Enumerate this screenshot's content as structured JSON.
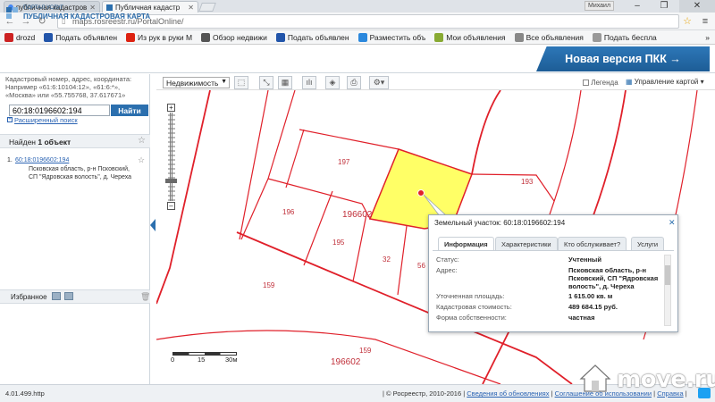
{
  "browser": {
    "tabs": [
      {
        "label": "публичная кадастров",
        "favicon_color": "#4285f4"
      },
      {
        "label": "Публичная кадастр",
        "favicon_color": "#2b6fae"
      }
    ],
    "user_label": "Михаил",
    "url": "maps.rosreestr.ru/PortalOnline/",
    "bookmarks": [
      {
        "label": "drozd",
        "color": "#cc2222"
      },
      {
        "label": "Подать объявлен",
        "color": "#2255aa"
      },
      {
        "label": "Из рук в руки М",
        "color": "#dd2211"
      },
      {
        "label": "Обзор недвижи",
        "color": "#555555"
      },
      {
        "label": "Подать объявлен",
        "color": "#2255aa"
      },
      {
        "label": "Разместить объ",
        "color": "#2b88dd"
      },
      {
        "label": "Мои объявления",
        "color": "#88aa33"
      },
      {
        "label": "Все объявления",
        "color": "#888888"
      },
      {
        "label": "Подать беспла",
        "color": "#999999"
      }
    ]
  },
  "header": {
    "logo_top": "ПОРТАЛ УСЛУГ",
    "logo_title": "ПУБЛИЧНАЯ КАДАСТРОВАЯ КАРТА",
    "new_version": "Новая версия ПКК →"
  },
  "left": {
    "hint_title": "Кадастровый номер, адрес, координата:",
    "hint_example": "Например «61:6:10104:12», «61:6:*»,",
    "hint_example2": "«Москва» или «55.755768, 37.617671»",
    "search_value": "60:18:0196602:194",
    "search_button": "Найти",
    "advanced_search": "Расширенный поиск",
    "found_prefix": "Найден",
    "found_count": "1 объект",
    "result_number": "1.",
    "result_link": "60:18:0196602:194",
    "result_address": "Псковская область, р-н Псковский, СП \"Ядровская волость\", д. Череха",
    "favorites_label": "Избранное"
  },
  "toolbar": {
    "layer_select": "Недвижимость",
    "legend_label": "Легенда",
    "manage_label": "Управление картой"
  },
  "map": {
    "labels": [
      "197",
      "196602",
      "196",
      "195",
      "32",
      "56",
      "159",
      "159",
      "196602",
      "193"
    ],
    "scale_labels": [
      "0",
      "15",
      "30м"
    ]
  },
  "popup": {
    "title": "Земельный участок: 60:18:0196602:194",
    "tabs": [
      "Информация",
      "Характеристики",
      "Кто обслуживает?",
      "Услуги"
    ],
    "rows": [
      {
        "key": "Статус:",
        "value": "Учтенный"
      },
      {
        "key": "Адрес:",
        "value": "Псковская область, р-н Псковский, СП \"Ядровская волость\", д. Череха"
      },
      {
        "key": "Уточненная площадь:",
        "value": "1 615.00 кв. м"
      },
      {
        "key": "Кадастровая стоимость:",
        "value": "489 684.15 руб."
      },
      {
        "key": "Форма собственности:",
        "value": "частная"
      }
    ]
  },
  "footer": {
    "version": "4.01.499.http",
    "copyright": "| © Росреестр, 2010-2016 |",
    "link_updates": "Сведения об обновлениях",
    "separator1": "|",
    "link_agreement": "Соглашение об использовании",
    "separator2": "|",
    "link_help": "Справка",
    "separator3": "|"
  },
  "watermark": "move.ru",
  "colors": {
    "accent": "#2b6fae",
    "parcel_border": "#e0202a",
    "parcel_selected": "#ffff66"
  }
}
